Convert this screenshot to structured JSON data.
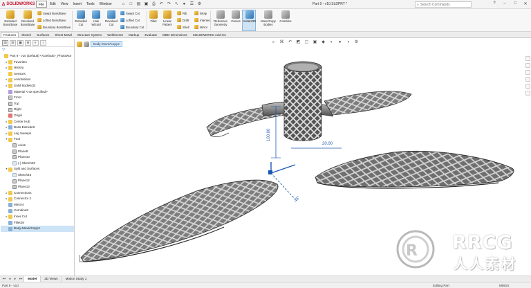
{
  "app": {
    "name": "SOLIDWORKS",
    "document_title": "Part 9 - v10.SLDPRT *"
  },
  "menus": [
    "File",
    "Edit",
    "View",
    "Insert",
    "Tools",
    "Window"
  ],
  "search": {
    "placeholder": "Search Commands"
  },
  "ribbon": {
    "extruded_boss": "Extruded Boss/Base",
    "revolved_boss": "Revolved Boss/Base",
    "swept_boss": "Swept Boss/Base",
    "lofted_boss": "Lofted Boss/Base",
    "boundary_boss": "Boundary Boss/Base",
    "extruded_cut": "Extruded Cut",
    "hole_wizard": "Hole Wizard",
    "revolved_cut": "Revolved Cut",
    "swept_cut": "Swept Cut",
    "lofted_cut": "Lofted Cut",
    "boundary_cut": "Boundary Cut",
    "fillet": "Fillet",
    "linear_pattern": "Linear Pattern",
    "rib": "Rib",
    "draft": "Draft",
    "shell": "Shell",
    "wrap": "Wrap",
    "intersect": "Intersect",
    "mirror": "Mirror",
    "reference_geometry": "Reference Geometry",
    "curves": "Curves",
    "instant3d": "Instant3D",
    "move_copy": "Move/Copy Bodies",
    "combine": "Combine"
  },
  "cmd_tabs": [
    "Features",
    "Sketch",
    "Surfaces",
    "Sheet Metal",
    "Structure System",
    "Weldments",
    "Markup",
    "Evaluate",
    "MBD Dimensions",
    "SOLIDWORKS Add-Ins"
  ],
  "tree": [
    {
      "label": "Part 9 - v10 (Default) <<Default>_PhotoWor",
      "icon": "part",
      "level": 0,
      "expander": ""
    },
    {
      "label": "Favorites",
      "icon": "folder",
      "level": 1,
      "expander": "▸"
    },
    {
      "label": "History",
      "icon": "folder",
      "level": 1,
      "expander": "▸"
    },
    {
      "label": "Sensors",
      "icon": "folder",
      "level": 1,
      "expander": ""
    },
    {
      "label": "Annotations",
      "icon": "folder",
      "level": 1,
      "expander": "▸"
    },
    {
      "label": "Solid Bodies(3)",
      "icon": "folder",
      "level": 1,
      "expander": "▸"
    },
    {
      "label": "Material <not specified>",
      "icon": "material",
      "level": 1,
      "expander": ""
    },
    {
      "label": "Front",
      "icon": "plane",
      "level": 1,
      "expander": ""
    },
    {
      "label": "Top",
      "icon": "plane",
      "level": 1,
      "expander": ""
    },
    {
      "label": "Right",
      "icon": "plane",
      "level": 1,
      "expander": ""
    },
    {
      "label": "Origin",
      "icon": "origin",
      "level": 1,
      "expander": ""
    },
    {
      "label": "Center Hub",
      "icon": "folder",
      "level": 1,
      "expander": "▸"
    },
    {
      "label": "Boss-Extrude6",
      "icon": "feature",
      "level": 1,
      "expander": "▸"
    },
    {
      "label": "Leg Sweeps",
      "icon": "folder",
      "level": 1,
      "expander": "▸"
    },
    {
      "label": "Foot",
      "icon": "folder",
      "level": 1,
      "expander": "▾"
    },
    {
      "label": "Axis1",
      "icon": "plane",
      "level": 2,
      "expander": ""
    },
    {
      "label": "Plane9",
      "icon": "plane",
      "level": 2,
      "expander": ""
    },
    {
      "label": "Plane10",
      "icon": "plane",
      "level": 2,
      "expander": ""
    },
    {
      "label": "(-) Sketch30",
      "icon": "sketch",
      "level": 2,
      "expander": ""
    },
    {
      "label": "Split and Surfaces",
      "icon": "folder",
      "level": 1,
      "expander": "▾"
    },
    {
      "label": "Sketch45",
      "icon": "sketch",
      "level": 2,
      "expander": ""
    },
    {
      "label": "Plane12",
      "icon": "plane",
      "level": 2,
      "expander": ""
    },
    {
      "label": "Plane13",
      "icon": "plane",
      "level": 2,
      "expander": ""
    },
    {
      "label": "Connections",
      "icon": "folder",
      "level": 1,
      "expander": "▸"
    },
    {
      "label": "Connector 2",
      "icon": "folder",
      "level": 1,
      "expander": "▸"
    },
    {
      "label": "Mirror4",
      "icon": "feature",
      "level": 1,
      "expander": ""
    },
    {
      "label": "Combine8",
      "icon": "feature",
      "level": 1,
      "expander": ""
    },
    {
      "label": "Inner Cut",
      "icon": "folder",
      "level": 1,
      "expander": "▸"
    },
    {
      "label": "Fillet28",
      "icon": "feature",
      "level": 1,
      "expander": ""
    },
    {
      "label": "Body-Move/Copy2",
      "icon": "feature",
      "level": 1,
      "expander": "",
      "selected": true
    }
  ],
  "graphics": {
    "breadcrumb": "Body-Move/Copy2"
  },
  "model": {
    "dim_vertical": "100.00",
    "dim_horizontal": "20.00",
    "dim_angle": "45°"
  },
  "watermark": {
    "title": "RRCG",
    "subtitle": "人人素材"
  },
  "bottom_tabs": [
    "Model",
    "3D Views",
    "Motion Study 1"
  ],
  "status": {
    "left": "Part 9 - v10",
    "editing": "Editing Part",
    "units": "MMGS"
  },
  "colors": {
    "brand": "#c8102e",
    "selection": "#cde3f6",
    "dimension": "#1b57b5"
  }
}
